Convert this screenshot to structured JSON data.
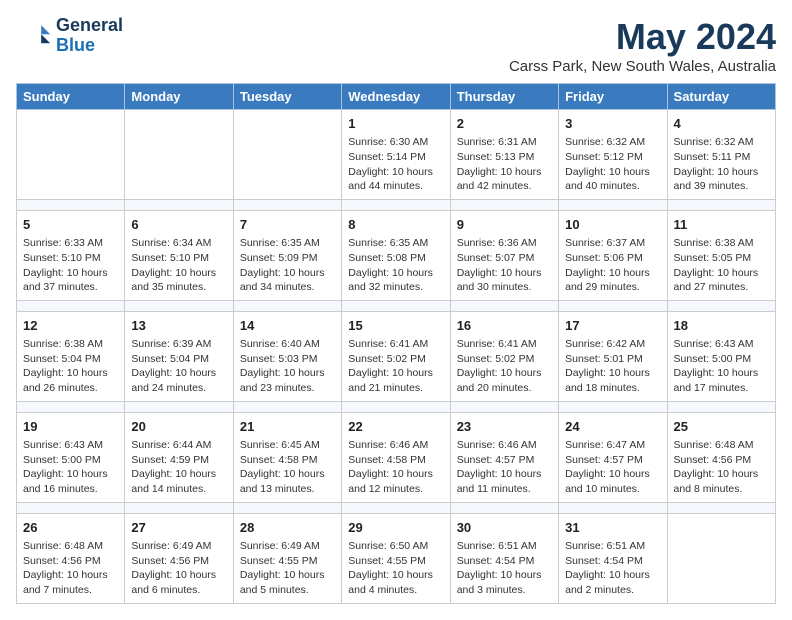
{
  "logo": {
    "line1": "General",
    "line2": "Blue"
  },
  "title": "May 2024",
  "location": "Carss Park, New South Wales, Australia",
  "days_of_week": [
    "Sunday",
    "Monday",
    "Tuesday",
    "Wednesday",
    "Thursday",
    "Friday",
    "Saturday"
  ],
  "weeks": [
    [
      {
        "day": "",
        "info": ""
      },
      {
        "day": "",
        "info": ""
      },
      {
        "day": "",
        "info": ""
      },
      {
        "day": "1",
        "info": "Sunrise: 6:30 AM\nSunset: 5:14 PM\nDaylight: 10 hours\nand 44 minutes."
      },
      {
        "day": "2",
        "info": "Sunrise: 6:31 AM\nSunset: 5:13 PM\nDaylight: 10 hours\nand 42 minutes."
      },
      {
        "day": "3",
        "info": "Sunrise: 6:32 AM\nSunset: 5:12 PM\nDaylight: 10 hours\nand 40 minutes."
      },
      {
        "day": "4",
        "info": "Sunrise: 6:32 AM\nSunset: 5:11 PM\nDaylight: 10 hours\nand 39 minutes."
      }
    ],
    [
      {
        "day": "5",
        "info": "Sunrise: 6:33 AM\nSunset: 5:10 PM\nDaylight: 10 hours\nand 37 minutes."
      },
      {
        "day": "6",
        "info": "Sunrise: 6:34 AM\nSunset: 5:10 PM\nDaylight: 10 hours\nand 35 minutes."
      },
      {
        "day": "7",
        "info": "Sunrise: 6:35 AM\nSunset: 5:09 PM\nDaylight: 10 hours\nand 34 minutes."
      },
      {
        "day": "8",
        "info": "Sunrise: 6:35 AM\nSunset: 5:08 PM\nDaylight: 10 hours\nand 32 minutes."
      },
      {
        "day": "9",
        "info": "Sunrise: 6:36 AM\nSunset: 5:07 PM\nDaylight: 10 hours\nand 30 minutes."
      },
      {
        "day": "10",
        "info": "Sunrise: 6:37 AM\nSunset: 5:06 PM\nDaylight: 10 hours\nand 29 minutes."
      },
      {
        "day": "11",
        "info": "Sunrise: 6:38 AM\nSunset: 5:05 PM\nDaylight: 10 hours\nand 27 minutes."
      }
    ],
    [
      {
        "day": "12",
        "info": "Sunrise: 6:38 AM\nSunset: 5:04 PM\nDaylight: 10 hours\nand 26 minutes."
      },
      {
        "day": "13",
        "info": "Sunrise: 6:39 AM\nSunset: 5:04 PM\nDaylight: 10 hours\nand 24 minutes."
      },
      {
        "day": "14",
        "info": "Sunrise: 6:40 AM\nSunset: 5:03 PM\nDaylight: 10 hours\nand 23 minutes."
      },
      {
        "day": "15",
        "info": "Sunrise: 6:41 AM\nSunset: 5:02 PM\nDaylight: 10 hours\nand 21 minutes."
      },
      {
        "day": "16",
        "info": "Sunrise: 6:41 AM\nSunset: 5:02 PM\nDaylight: 10 hours\nand 20 minutes."
      },
      {
        "day": "17",
        "info": "Sunrise: 6:42 AM\nSunset: 5:01 PM\nDaylight: 10 hours\nand 18 minutes."
      },
      {
        "day": "18",
        "info": "Sunrise: 6:43 AM\nSunset: 5:00 PM\nDaylight: 10 hours\nand 17 minutes."
      }
    ],
    [
      {
        "day": "19",
        "info": "Sunrise: 6:43 AM\nSunset: 5:00 PM\nDaylight: 10 hours\nand 16 minutes."
      },
      {
        "day": "20",
        "info": "Sunrise: 6:44 AM\nSunset: 4:59 PM\nDaylight: 10 hours\nand 14 minutes."
      },
      {
        "day": "21",
        "info": "Sunrise: 6:45 AM\nSunset: 4:58 PM\nDaylight: 10 hours\nand 13 minutes."
      },
      {
        "day": "22",
        "info": "Sunrise: 6:46 AM\nSunset: 4:58 PM\nDaylight: 10 hours\nand 12 minutes."
      },
      {
        "day": "23",
        "info": "Sunrise: 6:46 AM\nSunset: 4:57 PM\nDaylight: 10 hours\nand 11 minutes."
      },
      {
        "day": "24",
        "info": "Sunrise: 6:47 AM\nSunset: 4:57 PM\nDaylight: 10 hours\nand 10 minutes."
      },
      {
        "day": "25",
        "info": "Sunrise: 6:48 AM\nSunset: 4:56 PM\nDaylight: 10 hours\nand 8 minutes."
      }
    ],
    [
      {
        "day": "26",
        "info": "Sunrise: 6:48 AM\nSunset: 4:56 PM\nDaylight: 10 hours\nand 7 minutes."
      },
      {
        "day": "27",
        "info": "Sunrise: 6:49 AM\nSunset: 4:56 PM\nDaylight: 10 hours\nand 6 minutes."
      },
      {
        "day": "28",
        "info": "Sunrise: 6:49 AM\nSunset: 4:55 PM\nDaylight: 10 hours\nand 5 minutes."
      },
      {
        "day": "29",
        "info": "Sunrise: 6:50 AM\nSunset: 4:55 PM\nDaylight: 10 hours\nand 4 minutes."
      },
      {
        "day": "30",
        "info": "Sunrise: 6:51 AM\nSunset: 4:54 PM\nDaylight: 10 hours\nand 3 minutes."
      },
      {
        "day": "31",
        "info": "Sunrise: 6:51 AM\nSunset: 4:54 PM\nDaylight: 10 hours\nand 2 minutes."
      },
      {
        "day": "",
        "info": ""
      }
    ]
  ]
}
